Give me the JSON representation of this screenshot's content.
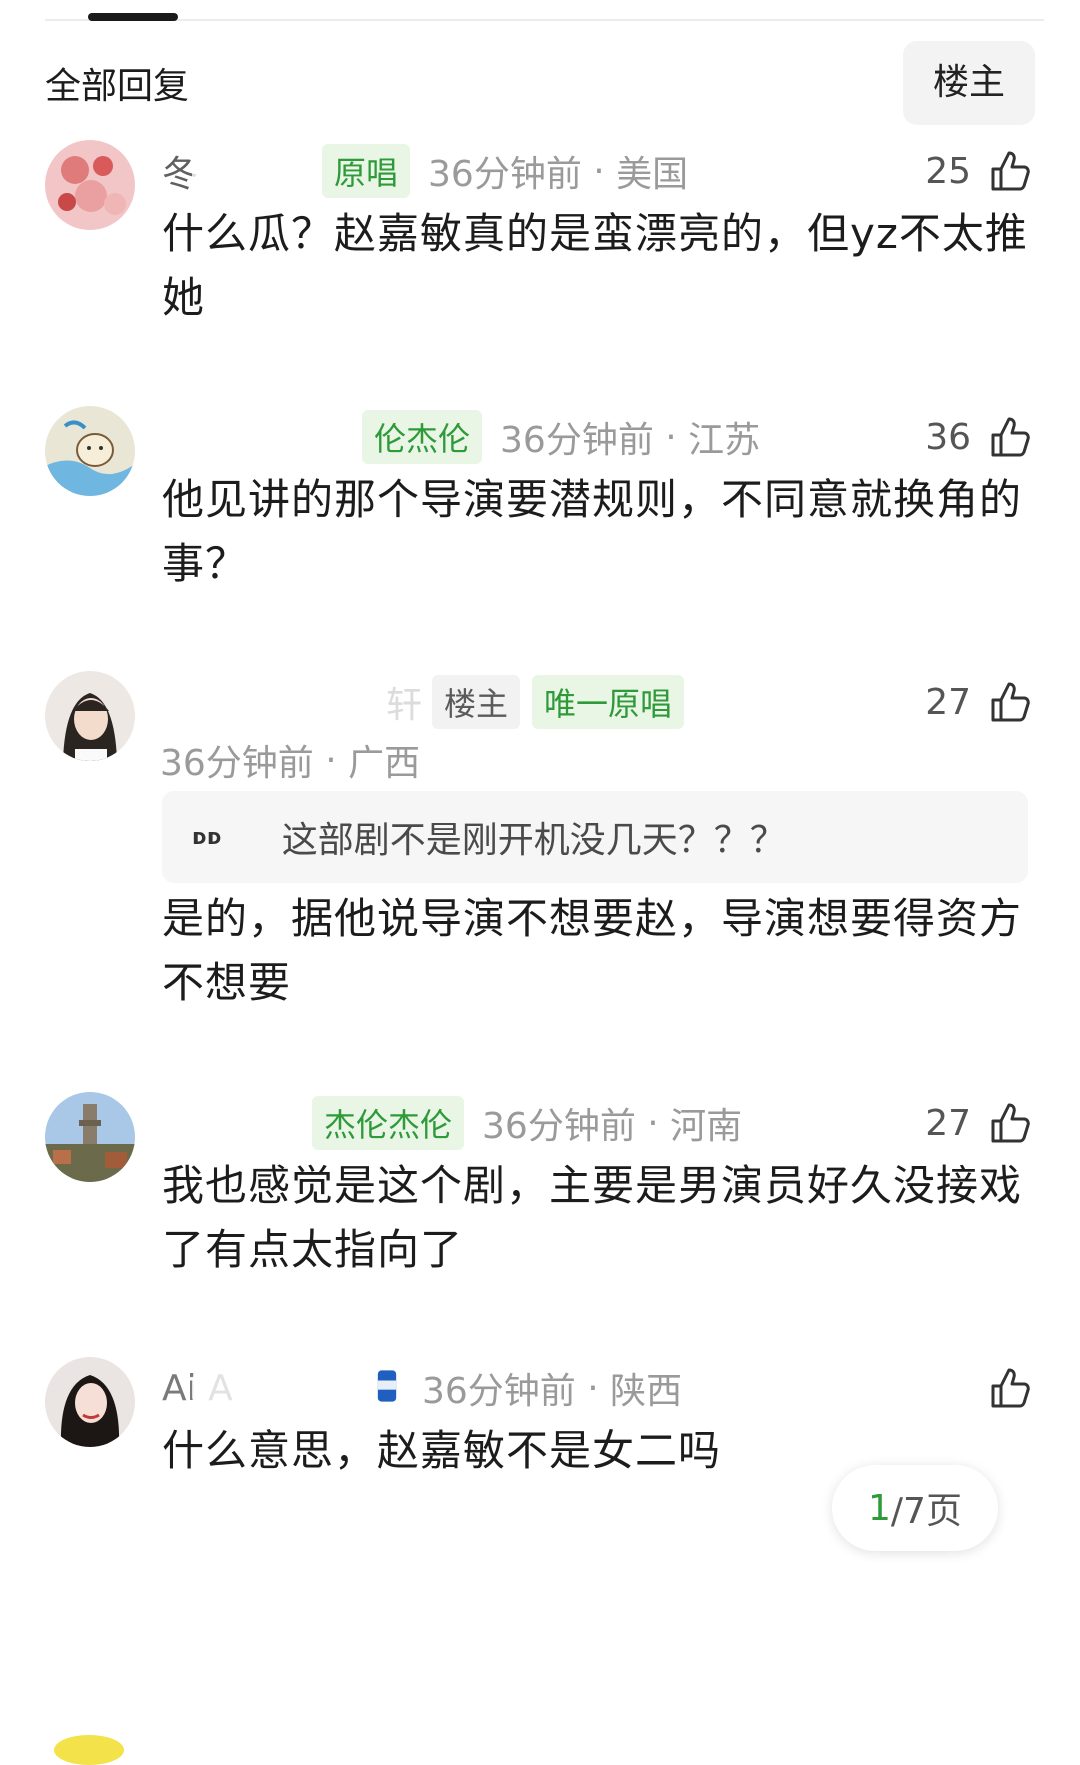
{
  "header": {
    "title": "全部回复",
    "filter_label": "楼主"
  },
  "comments": [
    {
      "username": "冬",
      "badge": "原唱",
      "time": "36分钟前",
      "location": "美国",
      "likes": "25",
      "text": "什么瓜？赵嘉敏真的是蛮漂亮的，但yz不太推她"
    },
    {
      "username": "",
      "badge": "伦杰伦",
      "time": "36分钟前",
      "location": "江苏",
      "likes": "36",
      "text": "他见讲的那个导演要潜规则，不同意就换角的事？"
    },
    {
      "username": "轩",
      "host_badge": "楼主",
      "badge": "唯一原唱",
      "time": "36分钟前",
      "location": "广西",
      "likes": "27",
      "quote": "这部剧不是刚开机没几天？？？",
      "text": "是的，据他说导演不想要赵，导演想要得资方不想要"
    },
    {
      "username": "",
      "badge": "杰伦杰伦",
      "time": "36分钟前",
      "location": "河南",
      "likes": "27",
      "text": "我也感觉是这个剧，主要是男演员好久没接戏了有点太指向了"
    },
    {
      "username": "Ai A",
      "time": "36分钟前",
      "location": "陕西",
      "likes": "",
      "text": "什么意思，赵嘉敏不是女二吗"
    }
  ],
  "pager": {
    "current": "1",
    "total_suffix": "/7页"
  }
}
